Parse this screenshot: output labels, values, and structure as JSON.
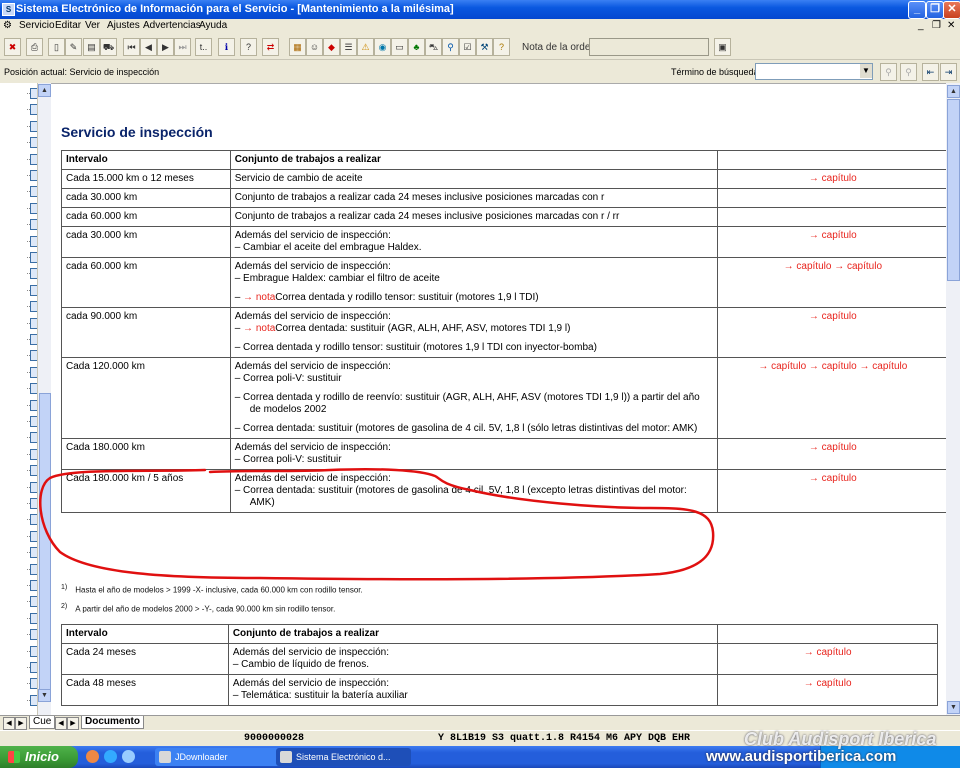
{
  "window": {
    "title": "Sistema Electrónico de Información para el Servicio - [Mantenimiento a la milésima]"
  },
  "menu": [
    "Servicio",
    "Editar",
    "Ver",
    "Ajustes",
    "Advertencias",
    "Ayuda"
  ],
  "toolbar": {
    "order_label": "Nota de la orden:",
    "order_value": ""
  },
  "position": {
    "label": "Posición actual: Servicio de inspección",
    "search_label": "Término de búsqueda:",
    "search_value": ""
  },
  "doc": {
    "title": "Servicio de inspección",
    "table1": {
      "headers": [
        "Intervalo",
        "Conjunto de trabajos a realizar",
        ""
      ],
      "rows": [
        {
          "interval": "Cada 15.000 km o 12 meses",
          "work": [
            "Servicio de cambio de aceite"
          ],
          "links": "→ capítulo"
        },
        {
          "interval": "cada 30.000 km",
          "work": [
            "Conjunto de trabajos a realizar cada 24 meses inclusive posiciones marcadas con r"
          ],
          "links": ""
        },
        {
          "interval": "cada 60.000 km",
          "work": [
            "Conjunto de trabajos a realizar cada 24 meses inclusive posiciones marcadas con r / rr"
          ],
          "links": ""
        },
        {
          "interval": "cada 30.000 km",
          "work": [
            "Además del servicio de inspección:",
            "–   Cambiar el aceite del embrague Haldex."
          ],
          "links": "→ capítulo"
        },
        {
          "interval": "cada 60.000 km",
          "work": [
            "Además del servicio de inspección:",
            "–   Embrague Haldex: cambiar el filtro de aceite",
            "–   → notaCorrea dentada y rodillo tensor: sustituir (motores 1,9 l TDI)"
          ],
          "links": "→ capítulo → capítulo"
        },
        {
          "interval": "cada 90.000 km",
          "work": [
            "Además del servicio de inspección:",
            "–   → notaCorrea dentada: sustituir (AGR, ALH, AHF, ASV, motores TDI 1,9 l)",
            "–   Correa dentada y rodillo tensor: sustituir (motores 1,9 l TDI con inyector-bomba)"
          ],
          "links": "→ capítulo"
        },
        {
          "interval": "Cada 120.000 km",
          "work": [
            "Además del servicio de inspección:",
            "–   Correa poli-V: sustituir",
            "–   Correa dentada y rodillo de reenvío: sustituir (AGR, ALH, AHF, ASV (motores TDI 1,9 l)) a partir del año de modelos 2002",
            "–   Correa dentada: sustituir (motores de gasolina de 4 cil. 5V, 1,8 l (sólo letras distintivas del motor: AMK)"
          ],
          "links": "→ capítulo → capítulo → capítulo"
        },
        {
          "interval": "Cada 180.000 km",
          "work": [
            "Además del servicio de inspección:",
            "–   Correa poli-V: sustituir"
          ],
          "links": "→ capítulo"
        },
        {
          "interval": "Cada 180.000 km / 5 años",
          "work": [
            "Además del servicio de inspección:",
            "–   Correa dentada: sustituir (motores de gasolina de 4 cil. 5V, 1,8 l (excepto letras distintivas del motor: AMK)"
          ],
          "links": "→ capítulo"
        }
      ]
    },
    "footnotes": [
      {
        "mark": "1)",
        "text": "Hasta el año de modelos > 1999 -X- inclusive, cada 60.000 km con rodillo tensor."
      },
      {
        "mark": "2)",
        "text": "A partir del año de modelos 2000 > -Y-, cada 90.000 km sin rodillo tensor."
      }
    ],
    "table2": {
      "headers": [
        "Intervalo",
        "Conjunto de trabajos a realizar",
        ""
      ],
      "rows": [
        {
          "interval": "Cada 24 meses",
          "work": [
            "Además del servicio de inspección:",
            "–   Cambio de líquido de frenos."
          ],
          "links": "→ capítulo"
        },
        {
          "interval": "Cada 48 meses",
          "work": [
            "Además del servicio de inspección:",
            "–   Telemática: sustituir la batería auxiliar"
          ],
          "links": "→ capítulo"
        }
      ]
    }
  },
  "tabs": [
    "Cue",
    "Documento"
  ],
  "status": {
    "order_no": "9000000028",
    "model": "Y   8L1B19   S3 quatt.1.8 R4154 M6   APY   DQB   EHR"
  },
  "taskbar": {
    "start": "Inicio",
    "tasks": [
      "JDownloader",
      "Sistema Electrónico d..."
    ]
  },
  "watermark": {
    "line1": "Club Audisport Iberica",
    "line2": "www.audisportiberica.com"
  },
  "colors": {
    "link": "#e8241d",
    "title": "#0a246a",
    "annotation": "#e01010"
  }
}
